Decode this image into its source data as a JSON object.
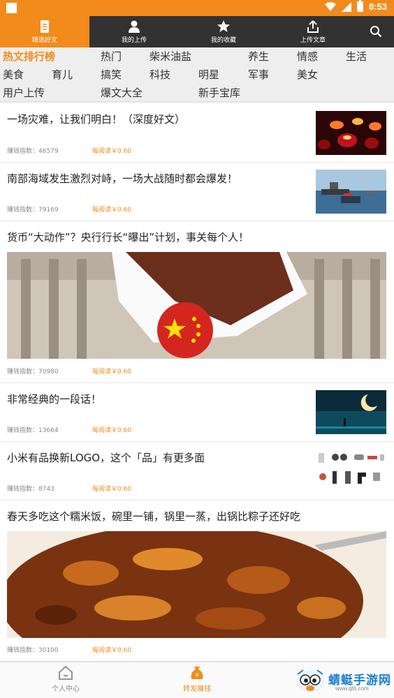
{
  "status_bar": {
    "time": "8:53"
  },
  "tabs": [
    {
      "label": "精选好文",
      "icon": "document-icon",
      "active": true
    },
    {
      "label": "我的上传",
      "icon": "user-icon",
      "active": false
    },
    {
      "label": "我的收藏",
      "icon": "star-icon",
      "active": false
    },
    {
      "label": "上传文章",
      "icon": "upload-icon",
      "active": false
    }
  ],
  "search": {
    "icon": "search-icon"
  },
  "categories": [
    "热文排行榜",
    "热门",
    "柴米油盐",
    "养生",
    "情感",
    "生活",
    "美食",
    "育儿",
    "搞笑",
    "科技",
    "明星",
    "军事",
    "美女",
    "用户上传",
    "爆文大全",
    "新手宝库"
  ],
  "feed": [
    {
      "title": "一场灾难，让我们明白！（深度好文）",
      "index": "赚钱指数：46579",
      "rate": "每阅读￥0.60"
    },
    {
      "title": "南部海域发生激烈对峙，一场大战随时都会爆发！",
      "index": "赚钱指数：79169",
      "rate": "每阅读￥0.60"
    },
    {
      "title": "货币“大动作”？央行行长“曝出”计划，事关每个人！",
      "index": "赚钱指数：70980",
      "rate": "每阅读￥0.60"
    },
    {
      "title": "非常经典的一段话！",
      "index": "赚钱指数：13664",
      "rate": "每阅读￥0.60"
    },
    {
      "title": "小米有品换新LOGO，这个「品」有更多面",
      "index": "赚钱指数：8743",
      "rate": "每阅读￥0.60"
    },
    {
      "title": "春天多吃这个糯米饭，碗里一铺，锅里一蒸，出锅比粽子还好吃",
      "index": "赚钱指数：30100",
      "rate": "每阅读￥0.60"
    }
  ],
  "bottom_nav": [
    {
      "label": "个人中心",
      "icon": "home-icon",
      "active": false
    },
    {
      "label": "转发赚钱",
      "icon": "money-bag-icon",
      "active": true
    }
  ],
  "watermark": {
    "text": "蜻蜓手游网",
    "url": "www.qt6.com"
  },
  "colors": {
    "accent": "#f28b1c",
    "tab_bar": "#323232"
  }
}
